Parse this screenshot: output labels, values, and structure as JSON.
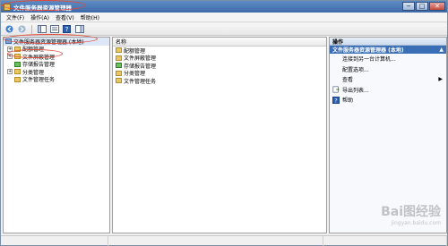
{
  "window": {
    "title": "文件服务器资源管理器",
    "controls": {
      "minimize": "−",
      "maximize": "□",
      "close": "✕"
    }
  },
  "menu": {
    "items": [
      {
        "label": "文件(F)"
      },
      {
        "label": "操作(A)"
      },
      {
        "label": "查看(V)"
      },
      {
        "label": "帮助(H)"
      }
    ]
  },
  "toolbar": {
    "buttons": [
      "back-icon",
      "forward-icon",
      "console-tree-icon",
      "properties-icon",
      "help-icon",
      "show-hide-icon"
    ]
  },
  "tree": {
    "root": "文件服务器资源管理器 (本地)",
    "items": [
      {
        "label": "配额管理",
        "expander": "+"
      },
      {
        "label": "文件屏蔽管理",
        "expander": "+"
      },
      {
        "label": "存储报告管理",
        "expander": ""
      },
      {
        "label": "分类管理",
        "expander": "+"
      },
      {
        "label": "文件管理任务",
        "expander": ""
      }
    ]
  },
  "list": {
    "header": "名称",
    "rows": [
      "配额管理",
      "文件屏蔽管理",
      "存储报告管理",
      "分类管理",
      "文件管理任务"
    ]
  },
  "actions": {
    "title": "操作",
    "section": "文件服务器资源管理器 (本地)",
    "items": [
      {
        "label": "连接到另一台计算机..."
      },
      {
        "label": "配置选项..."
      },
      {
        "label": "查看"
      },
      {
        "label": "导出列表..."
      },
      {
        "label": "帮助"
      }
    ]
  },
  "watermark": {
    "brand": "Bai图经验",
    "url": "jingyan.baidu.com"
  },
  "colors": {
    "annotation": "#e04a3a",
    "titlebar": "#3e6aa8",
    "action_section": "#3a6eb5"
  }
}
